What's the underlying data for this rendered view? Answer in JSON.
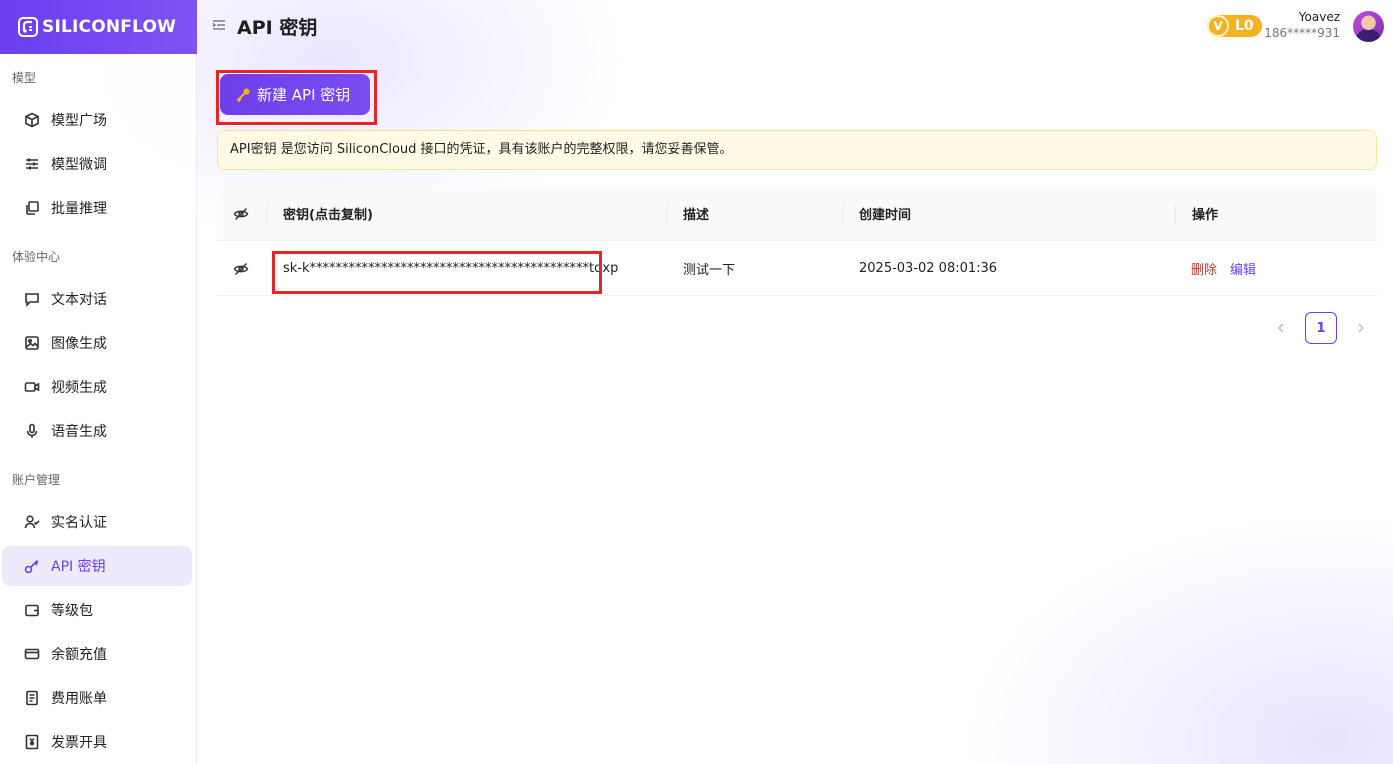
{
  "brand": {
    "name": "SILICONFLOW",
    "accent": "#6b3ef0"
  },
  "header": {
    "title": "API 密钥",
    "level": {
      "badge": "V",
      "label": "L0",
      "color": "#f6b31f"
    },
    "user": {
      "name": "Yoavez",
      "phone": "186*****931"
    }
  },
  "sidebar": {
    "sections": [
      {
        "label": "模型"
      },
      {
        "label": "体验中心"
      },
      {
        "label": "账户管理"
      }
    ],
    "items": [
      {
        "label": "模型广场",
        "icon": "cube-icon"
      },
      {
        "label": "模型微调",
        "icon": "sliders-icon"
      },
      {
        "label": "批量推理",
        "icon": "layers-icon"
      },
      {
        "label": "文本对话",
        "icon": "chat-icon"
      },
      {
        "label": "图像生成",
        "icon": "image-icon"
      },
      {
        "label": "视频生成",
        "icon": "video-icon"
      },
      {
        "label": "语音生成",
        "icon": "microphone-icon"
      },
      {
        "label": "实名认证",
        "icon": "user-check-icon"
      },
      {
        "label": "API 密钥",
        "icon": "key-icon",
        "active": true
      },
      {
        "label": "等级包",
        "icon": "wallet-icon"
      },
      {
        "label": "余额充值",
        "icon": "credit-card-icon"
      },
      {
        "label": "费用账单",
        "icon": "receipt-icon"
      },
      {
        "label": "发票开具",
        "icon": "invoice-icon"
      }
    ]
  },
  "actions": {
    "create_label": "新建 API 密钥"
  },
  "notice": {
    "text": "API密钥 是您访问 SiliconCloud 接口的凭证，具有该账户的完整权限，请您妥善保管。"
  },
  "table": {
    "columns": [
      "密钥(点击复制)",
      "描述",
      "创建时间",
      "操作"
    ],
    "rows": [
      {
        "key": "sk-k*******************************************tqxp",
        "description": "测试一下",
        "created": "2025-03-02 08:01:36",
        "delete_label": "删除",
        "edit_label": "编辑"
      }
    ]
  },
  "pagination": {
    "current": "1"
  }
}
